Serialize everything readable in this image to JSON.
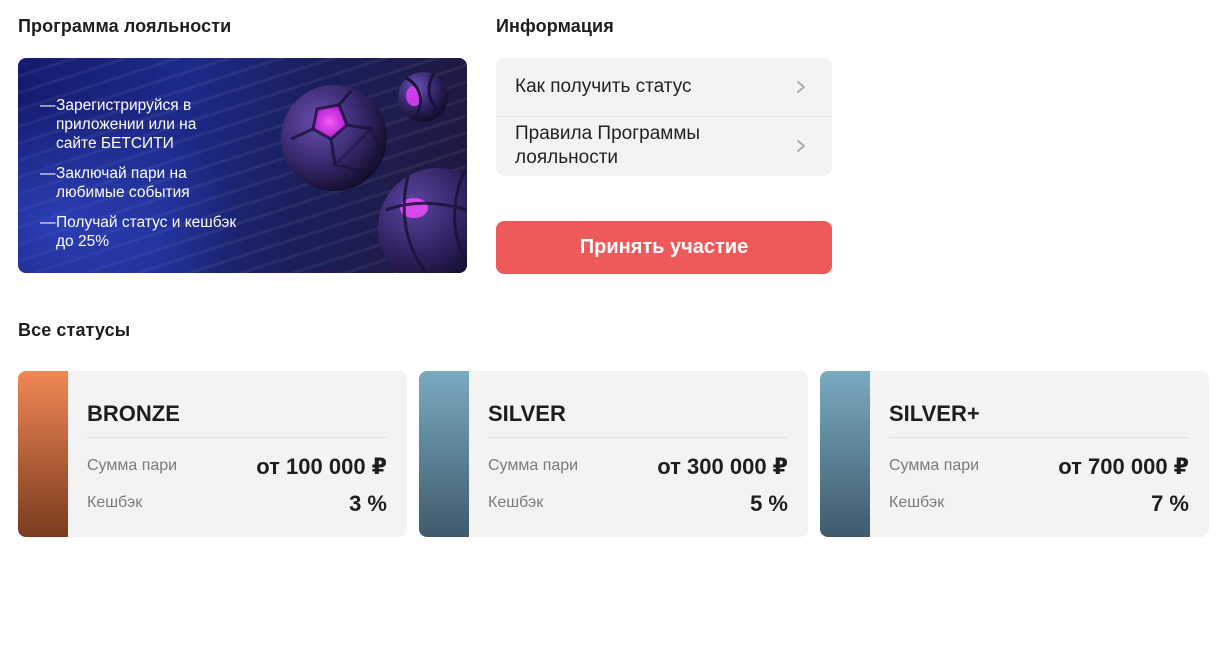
{
  "loyalty": {
    "title": "Программа лояльности",
    "banner": {
      "items": [
        "Зарегистрируйся в приложении или на сайте БЕТСИТИ",
        "Заключай пари на любимые события",
        "Получай статус и кешбэк до 25%"
      ],
      "image_icons": [
        "football-ball-icon",
        "tennis-ball-icon",
        "basketball-icon"
      ]
    }
  },
  "info": {
    "title": "Информация",
    "items": [
      {
        "label": "Как получить статус",
        "icon": "chevron-right-icon"
      },
      {
        "label": "Правила Программы лояльности",
        "icon": "chevron-right-icon"
      }
    ],
    "cta_label": "Принять участие"
  },
  "statuses": {
    "title": "Все статусы",
    "colors": {
      "bronze": [
        "#f08754",
        "#7a3b1f"
      ],
      "silver": [
        "#7aaac0",
        "#3f5a6c"
      ],
      "cta": "#ee5a59"
    },
    "cards": [
      {
        "name": "BRONZE",
        "bet_label": "Сумма пари",
        "bet_value": "от 100 000 ₽",
        "cashback_label": "Кешбэк",
        "cashback_value": "3 %"
      },
      {
        "name": "SILVER",
        "bet_label": "Сумма пари",
        "bet_value": "от 300 000 ₽",
        "cashback_label": "Кешбэк",
        "cashback_value": "5 %"
      },
      {
        "name": "SILVER+",
        "bet_label": "Сумма пари",
        "bet_value": "от 700 000 ₽",
        "cashback_label": "Кешбэк",
        "cashback_value": "7 %"
      }
    ]
  }
}
